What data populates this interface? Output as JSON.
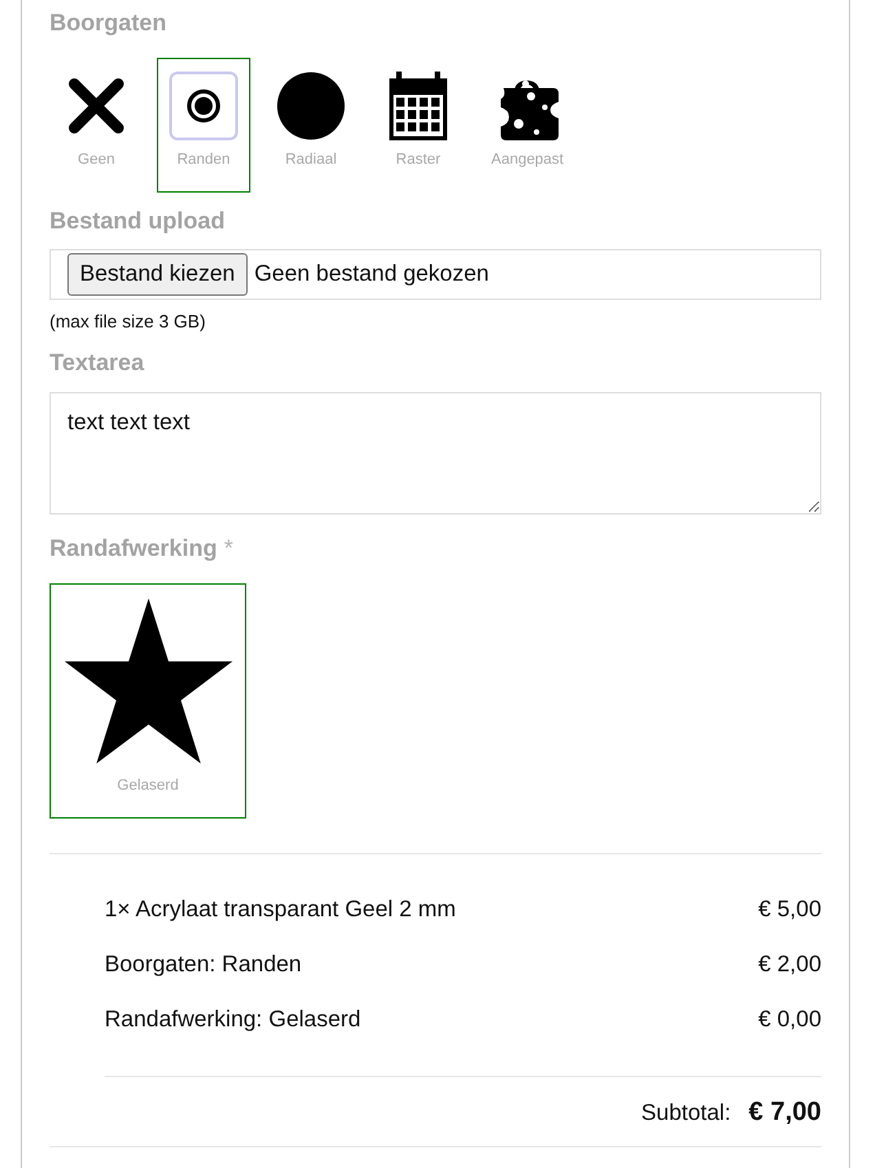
{
  "drill_holes": {
    "label": "Boorgaten",
    "options": [
      {
        "kind": "cross",
        "label": "Geen",
        "selected": false
      },
      {
        "kind": "target",
        "label": "Randen",
        "selected": true
      },
      {
        "kind": "disc",
        "label": "Radiaal",
        "selected": false
      },
      {
        "kind": "calendar",
        "label": "Raster",
        "selected": false
      },
      {
        "kind": "cheese",
        "label": "Aangepast",
        "selected": false
      }
    ]
  },
  "file_upload": {
    "label": "Bestand upload",
    "button": "Bestand kiezen",
    "status": "Geen bestand gekozen",
    "hint": "(max file size 3 GB)"
  },
  "textarea": {
    "label": "Textarea",
    "value": "text text text"
  },
  "edge_finish": {
    "label": "Randafwerking",
    "required_mark": "*",
    "options": [
      {
        "kind": "star",
        "label": "Gelaserd",
        "selected": true
      }
    ]
  },
  "summary": {
    "lines": [
      {
        "description": "1× Acrylaat transparant Geel 2 mm",
        "price": "€ 5,00"
      },
      {
        "description": "Boorgaten: Randen",
        "price": "€ 2,00"
      },
      {
        "description": "Randafwerking: Gelaserd",
        "price": "€ 0,00"
      }
    ],
    "subtotal_label": "Subtotal:",
    "subtotal": "€ 7,00"
  }
}
